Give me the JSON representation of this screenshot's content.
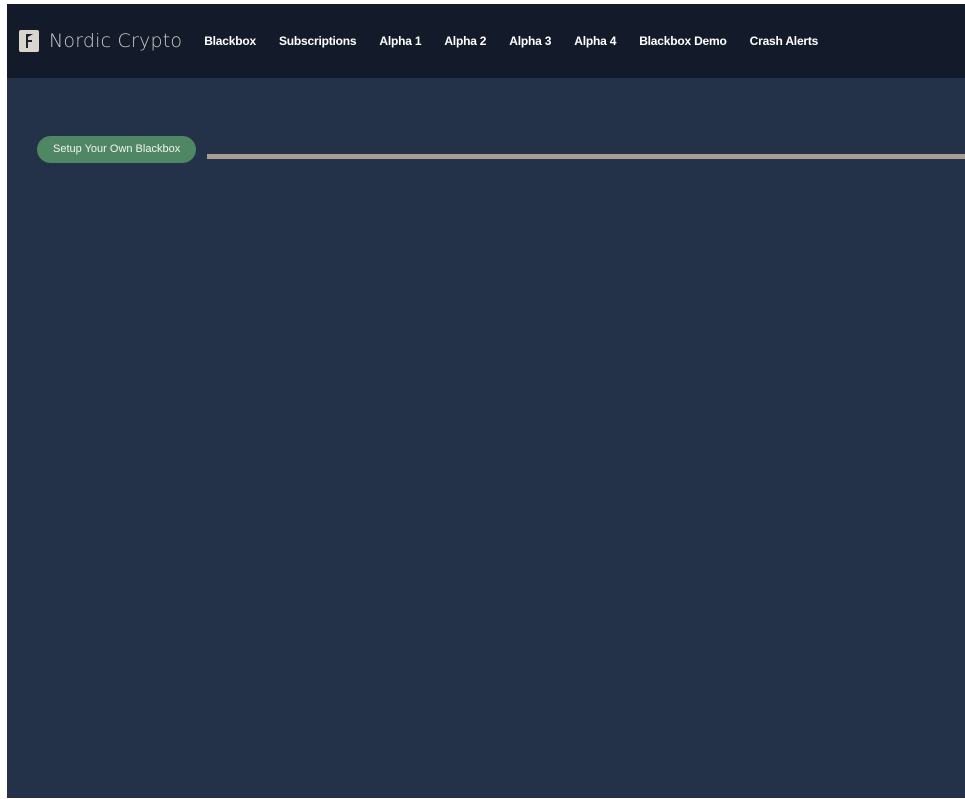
{
  "brand": {
    "name": "Nordic Crypto",
    "logo_icon": "nordic-crypto-logo-icon"
  },
  "nav": {
    "items": [
      {
        "label": "Blackbox"
      },
      {
        "label": "Subscriptions"
      },
      {
        "label": "Alpha 1"
      },
      {
        "label": "Alpha 2"
      },
      {
        "label": "Alpha 3"
      },
      {
        "label": "Alpha 4"
      },
      {
        "label": "Blackbox Demo"
      },
      {
        "label": "Crash Alerts"
      }
    ]
  },
  "main": {
    "setup_button_label": "Setup Your Own Blackbox"
  },
  "colors": {
    "navbar_bg": "#131a2a",
    "page_bg": "#233248",
    "button_bg": "#4f8764",
    "divider": "#a99e92"
  }
}
